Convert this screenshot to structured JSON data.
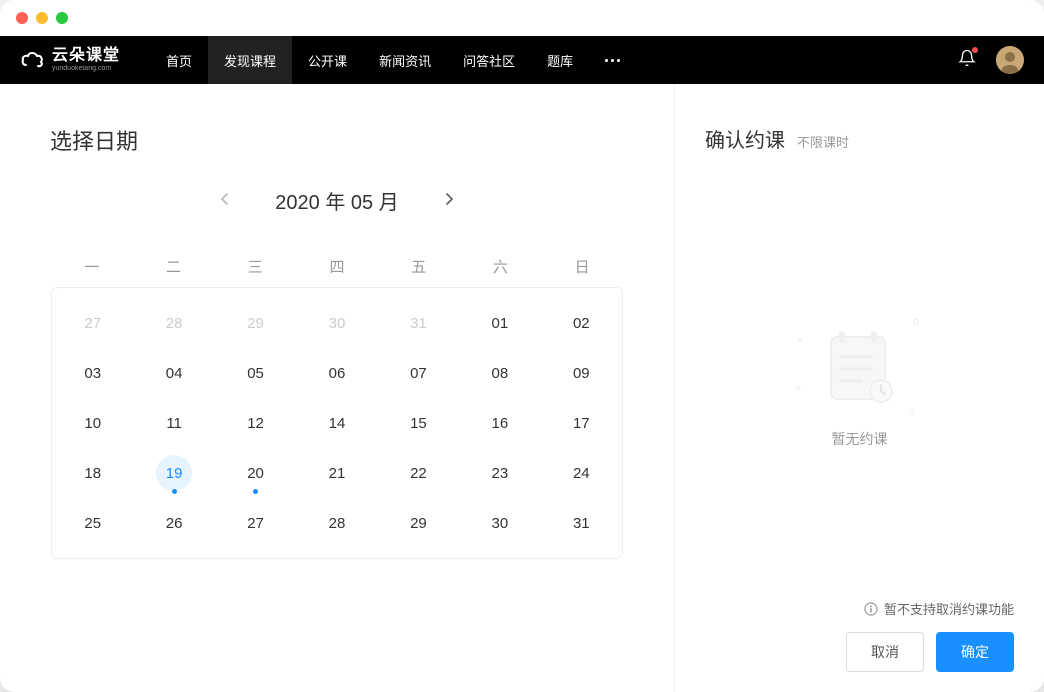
{
  "logo": {
    "main": "云朵课堂",
    "sub": "yunduoketang.com"
  },
  "nav": {
    "items": [
      "首页",
      "发现课程",
      "公开课",
      "新闻资讯",
      "问答社区",
      "题库"
    ],
    "active_index": 1
  },
  "left": {
    "title": "选择日期",
    "month_label": "2020 年 05 月",
    "weekdays": [
      "一",
      "二",
      "三",
      "四",
      "五",
      "六",
      "日"
    ],
    "days": [
      {
        "n": "27",
        "other": true
      },
      {
        "n": "28",
        "other": true
      },
      {
        "n": "29",
        "other": true
      },
      {
        "n": "30",
        "other": true
      },
      {
        "n": "31",
        "other": true
      },
      {
        "n": "01"
      },
      {
        "n": "02"
      },
      {
        "n": "03"
      },
      {
        "n": "04"
      },
      {
        "n": "05"
      },
      {
        "n": "06"
      },
      {
        "n": "07"
      },
      {
        "n": "08"
      },
      {
        "n": "09"
      },
      {
        "n": "10"
      },
      {
        "n": "11"
      },
      {
        "n": "12"
      },
      {
        "n": "14"
      },
      {
        "n": "15"
      },
      {
        "n": "16"
      },
      {
        "n": "17"
      },
      {
        "n": "18"
      },
      {
        "n": "19",
        "selected": true,
        "dot": true
      },
      {
        "n": "20",
        "dot": true
      },
      {
        "n": "21"
      },
      {
        "n": "22"
      },
      {
        "n": "23"
      },
      {
        "n": "24"
      },
      {
        "n": "25"
      },
      {
        "n": "26"
      },
      {
        "n": "27"
      },
      {
        "n": "28"
      },
      {
        "n": "29"
      },
      {
        "n": "30"
      },
      {
        "n": "31"
      }
    ]
  },
  "right": {
    "title": "确认约课",
    "subtitle": "不限课时",
    "empty_text": "暂无约课",
    "notice": "暂不支持取消约课功能",
    "cancel_label": "取消",
    "confirm_label": "确定"
  }
}
